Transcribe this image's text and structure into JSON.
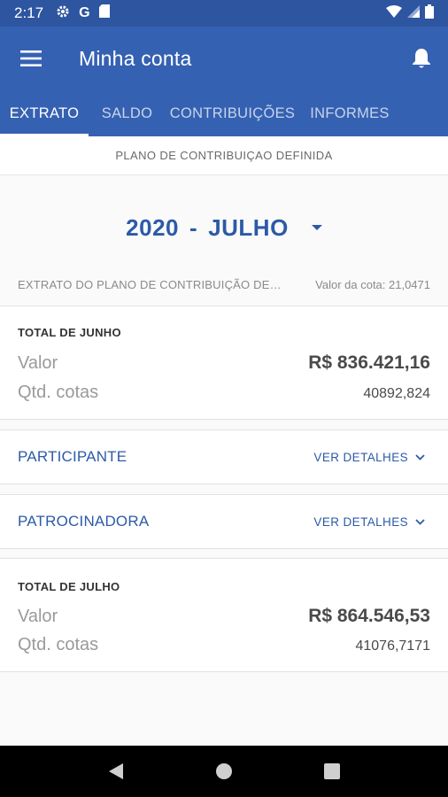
{
  "status_bar": {
    "time": "2:17",
    "icons": [
      "settings-icon",
      "google-icon",
      "sd-card-icon",
      "wifi-icon",
      "signal-icon",
      "battery-icon"
    ]
  },
  "app_bar": {
    "title": "Minha conta",
    "menu_icon": "menu-icon",
    "notification_icon": "bell-icon"
  },
  "tabs": [
    {
      "label": "EXTRATO",
      "active": true
    },
    {
      "label": "SALDO",
      "active": false
    },
    {
      "label": "CONTRIBUIÇÕES",
      "active": false
    },
    {
      "label": "INFORMES",
      "active": false
    }
  ],
  "plan_banner": "PLANO DE CONTRIBUIÇAO DEFINIDA",
  "period": {
    "year": "2020",
    "separator": "-",
    "month": "JULHO"
  },
  "extrato": {
    "description": "EXTRATO DO PLANO DE CONTRIBUIÇÃO DEFINIDA",
    "quota_value": "Valor da cota: 21,0471"
  },
  "total_previous": {
    "header": "TOTAL DE JUNHO",
    "value_label": "Valor",
    "value": "R$ 836.421,16",
    "quotas_label": "Qtd. cotas",
    "quotas": "40892,824"
  },
  "sections": [
    {
      "name": "PARTICIPANTE",
      "action": "VER DETALHES"
    },
    {
      "name": "PATROCINADORA",
      "action": "VER DETALHES"
    }
  ],
  "total_current": {
    "header": "TOTAL DE JULHO",
    "value_label": "Valor",
    "value": "R$ 864.546,53",
    "quotas_label": "Qtd. cotas",
    "quotas": "41076,7171"
  },
  "colors": {
    "primary": "#3561b2",
    "status_bar": "#2e55a0",
    "accent_text": "#2c5aa8"
  }
}
